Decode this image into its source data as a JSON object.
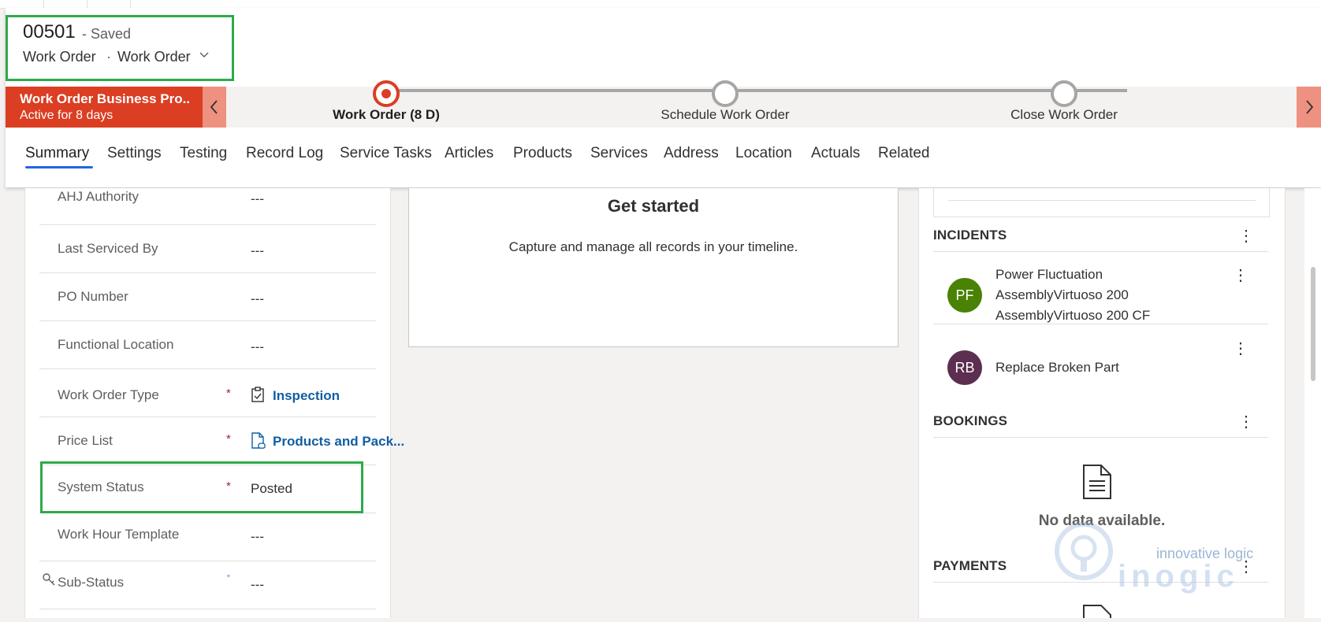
{
  "record": {
    "number": "00501",
    "saved_state": "- Saved",
    "entity": "Work Order",
    "separator": "·",
    "form": "Work Order"
  },
  "bpf": {
    "name": "Work Order Business Pro...",
    "duration": "Active for 8 days",
    "stages": [
      {
        "label": "Work Order  (8 D)",
        "active": true
      },
      {
        "label": "Schedule Work Order",
        "active": false
      },
      {
        "label": "Close Work Order",
        "active": false
      }
    ]
  },
  "tabs": [
    "Summary",
    "Settings",
    "Testing",
    "Record Log",
    "Service Tasks",
    "Articles",
    "Products",
    "Services",
    "Address",
    "Location",
    "Actuals",
    "Related"
  ],
  "selected_tab": "Summary",
  "fields": [
    {
      "label": "AHJ Authority",
      "value": "---"
    },
    {
      "label": "Last Serviced By",
      "value": "---"
    },
    {
      "label": "PO Number",
      "value": "---"
    },
    {
      "label": "Functional Location",
      "value": "---"
    },
    {
      "label": "Work Order Type",
      "required": "*",
      "value": "Inspection",
      "icon": "clipboard-icon"
    },
    {
      "label": "Price List",
      "required": "*",
      "value": "Products and Pack...",
      "icon": "document-icon"
    },
    {
      "label": "System Status",
      "required": "*",
      "value": "Posted"
    },
    {
      "label": "Work Hour Template",
      "value": "---"
    },
    {
      "label": "Sub-Status",
      "required": "⁺",
      "value": "---",
      "icon": "lock-icon"
    }
  ],
  "timeline": {
    "title": "Get started",
    "subtitle": "Capture and manage all records in your timeline."
  },
  "incidents": {
    "header": "INCIDENTS",
    "items": [
      {
        "initials": "PF",
        "color": "#498205",
        "lines": [
          "Power Fluctuation",
          "AssemblyVirtuoso 200",
          "AssemblyVirtuoso 200 CF"
        ]
      },
      {
        "initials": "RB",
        "color": "#5c2e4f",
        "lines": [
          "Replace Broken Part"
        ]
      }
    ]
  },
  "bookings": {
    "header": "BOOKINGS",
    "empty": "No data available."
  },
  "payments": {
    "header": "PAYMENTS"
  },
  "more_glyph": "⋮",
  "watermark": {
    "tagline": "innovative logic",
    "brand": "inogic"
  },
  "colors": {
    "bpf_active": "#db3e22",
    "highlight": "#2eaa4a",
    "link": "#115ea3",
    "tab_underline": "#2266e3"
  }
}
